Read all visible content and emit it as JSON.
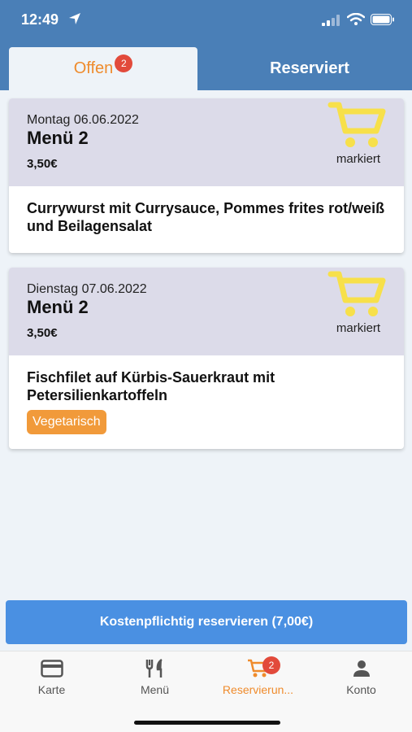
{
  "status": {
    "time": "12:49"
  },
  "tabs": [
    {
      "label": "Offen",
      "badge": "2"
    },
    {
      "label": "Reserviert"
    }
  ],
  "cards": [
    {
      "date": "Montag 06.06.2022",
      "menu": "Menü 2",
      "price": "3,50€",
      "status": "markiert",
      "description": "Currywurst mit Currysauce, Pommes frites rot/weiß und Beilagensalat",
      "tag": ""
    },
    {
      "date": "Dienstag 07.06.2022",
      "menu": "Menü 2",
      "price": "3,50€",
      "status": "markiert",
      "description": "Fischfilet auf Kürbis-Sauerkraut mit Petersilienkartoffeln",
      "tag": "Vegetarisch"
    }
  ],
  "reserve_button": "Kostenpflichtig reservieren (7,00€)",
  "nav": [
    {
      "label": "Karte",
      "icon": "card-icon"
    },
    {
      "label": "Menü",
      "icon": "cutlery-icon"
    },
    {
      "label": "Reservierun...",
      "icon": "cart-icon",
      "badge": "2",
      "active": true
    },
    {
      "label": "Konto",
      "icon": "person-icon"
    }
  ],
  "colors": {
    "header_blue": "#4a7fb7",
    "accent_orange": "#ef8b2c",
    "badge_red": "#e24a3b",
    "cart_yellow": "#f7e04a",
    "button_blue": "#4a90e2",
    "card_head": "#dcdbe9",
    "tag_orange": "#f19a3a"
  }
}
